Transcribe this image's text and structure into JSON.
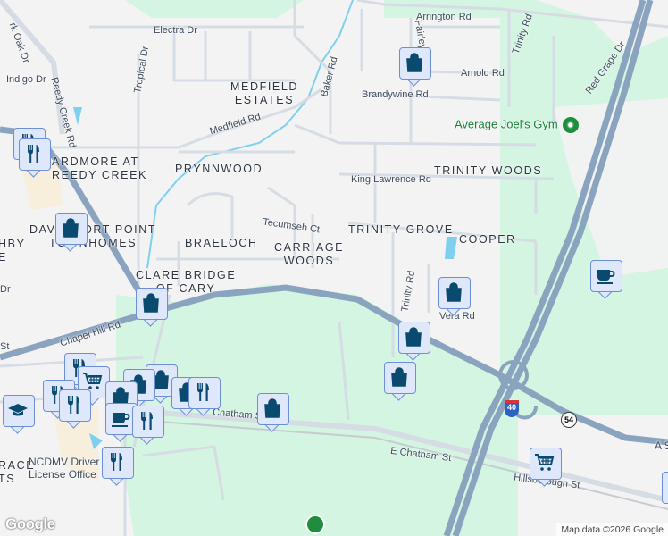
{
  "streets": {
    "electra": "Electra Dr",
    "arrington": "Arrington Rd",
    "trinity_top": "Trinity Rd",
    "fairley": "Fairley Dr",
    "arnold": "Arnold Rd",
    "red_grape": "Red Grape Dr",
    "oak": "rk Oak Dr",
    "tropical": "Tropical Dr",
    "baker": "Baker Rd",
    "brandywine": "Brandywine Rd",
    "indigo": "Indigo Dr",
    "reedy": "Reedy Creek Rd",
    "medfield": "Medfield Rd",
    "king_lawrence": "King Lawrence Rd",
    "tecumseh": "Tecumseh Ct",
    "trinity_mid": "Trinity Rd",
    "vera": "Vera Rd",
    "chapel_hill": "Chapel Hill Rd",
    "st_left": "St",
    "dr_left": "Dr",
    "chatham_w": "Chatham St",
    "chatham_e": "E Chatham St",
    "hillsborough": "Hillsborough St",
    "as": "A S"
  },
  "neighborhoods": {
    "medfield": "MEDFIELD\nESTATES",
    "prynnwood": "PRYNNWOOD",
    "ardmore": "ARDMORE AT\nREEDY CREEK",
    "davenport": "DAVENPORT POINT\nTOWNHOMES",
    "hby": "HBY\nE",
    "braeloch": "BRAELOCH",
    "carriage": "CARRIAGE\nWOODS",
    "clare": "CLARE BRIDGE\nOF CARY",
    "trinity_woods": "TRINITY WOODS",
    "trinity_grove": "TRINITY GROVE",
    "cooper": "COOPER",
    "terrace": "RACE\nTS"
  },
  "pois": {
    "gym": "Average Joel's Gym",
    "dmv": "NCDMV Driver\nLicense Office"
  },
  "shields": {
    "interstate": "40",
    "state": "54"
  },
  "attribution": {
    "logo": "Google",
    "copyright": "Map data ©2026 Google"
  },
  "colors": {
    "park": "#d3f5e1",
    "highway": "#8aa4c0",
    "road": "#d6dce3",
    "water": "#7fd0ef",
    "marker_bg": "#dfe8fb",
    "icon": "#0b4a6f"
  }
}
